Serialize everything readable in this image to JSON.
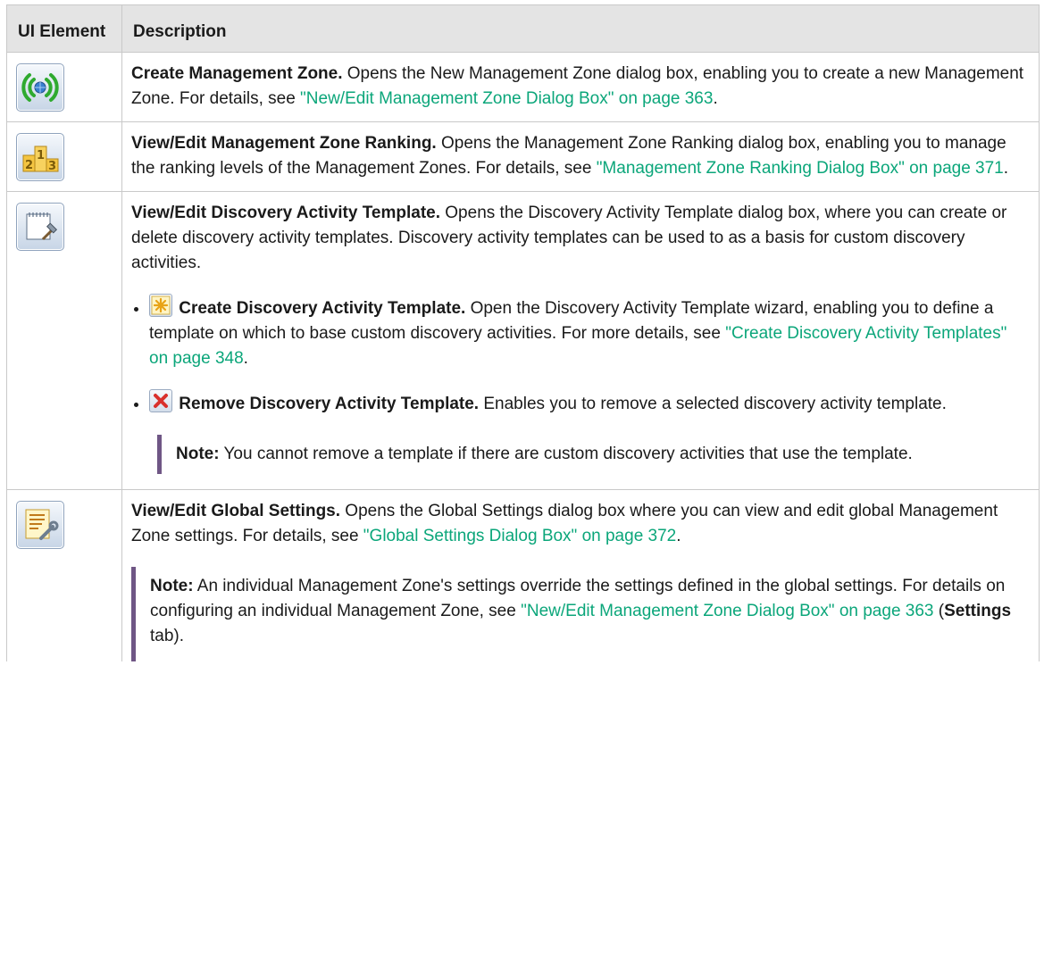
{
  "table": {
    "header_ui": "UI Element",
    "header_description": "Description"
  },
  "rows": [
    {
      "icon": "management-zone-broadcast-icon",
      "title": "Create Management Zone.",
      "text": " Opens the New Management Zone dialog box, enabling you to create a new Management Zone. For details, see ",
      "link": "\"New/Edit Management Zone Dialog Box\" on page 363",
      "after": "."
    },
    {
      "icon": "ranking-podium-icon",
      "title": "View/Edit Management Zone Ranking.",
      "text": " Opens the Management Zone Ranking dialog box, enabling you to manage the ranking levels of the Management Zones. For details, see ",
      "link": "\"Management Zone Ranking Dialog Box\" on page 371",
      "after": "."
    },
    {
      "icon": "notepad-hammer-icon",
      "title": "View/Edit Discovery Activity Template.",
      "text": " Opens the Discovery Activity Template dialog box, where you can create or delete discovery activity templates. Discovery activity templates can be used to as a basis for custom discovery activities.",
      "sub_items": [
        {
          "icon": "asterisk-new-icon",
          "title": "Create Discovery Activity Template.",
          "text": " Open the Discovery Activity Template wizard, enabling you to define a template on which to base custom discovery activities. For more details, see ",
          "link": "\"Create Discovery Activity Templates\" on page 348",
          "after": "."
        },
        {
          "icon": "red-x-remove-icon",
          "title": "Remove Discovery Activity Template.",
          "text": " Enables you to remove a selected discovery activity template."
        }
      ],
      "note_label": "Note:",
      "note_text": " You cannot remove a template if there are custom discovery activities that use the template."
    },
    {
      "icon": "settings-document-wrench-icon",
      "title": "View/Edit Global Settings.",
      "text": " Opens the Global Settings dialog box where you can view and edit global Management Zone settings. For details, see ",
      "link": "\"Global Settings Dialog Box\" on page 372",
      "after": ".",
      "note_label": "Note:",
      "note_text": " An individual Management Zone's settings override the settings defined in the global settings. For details on configuring an individual Management Zone, see ",
      "note_link": "\"New/Edit Management Zone Dialog Box\" on page 363",
      "note_after_open": " (",
      "note_bold": "Settings",
      "note_after_close": " tab)."
    }
  ]
}
